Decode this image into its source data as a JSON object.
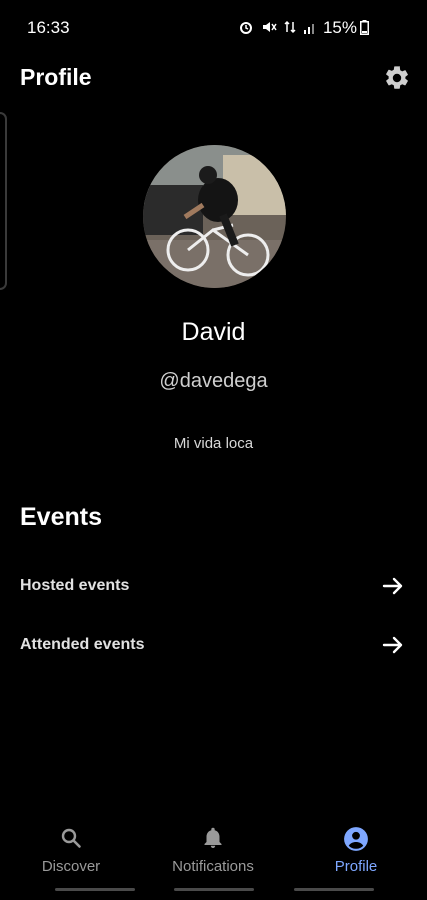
{
  "status_bar": {
    "time": "16:33",
    "battery": "15%"
  },
  "header": {
    "title": "Profile"
  },
  "profile": {
    "name": "David",
    "username": "@davedega",
    "bio": "Mi vida loca"
  },
  "events": {
    "title": "Events",
    "items": [
      {
        "label": "Hosted events"
      },
      {
        "label": "Attended events"
      }
    ]
  },
  "bottom_nav": {
    "items": [
      {
        "label": "Discover",
        "icon": "search-icon"
      },
      {
        "label": "Notifications",
        "icon": "bell-icon"
      },
      {
        "label": "Profile",
        "icon": "account-circle-icon"
      }
    ],
    "active": "Profile",
    "active_color": "#7ea7ff"
  }
}
